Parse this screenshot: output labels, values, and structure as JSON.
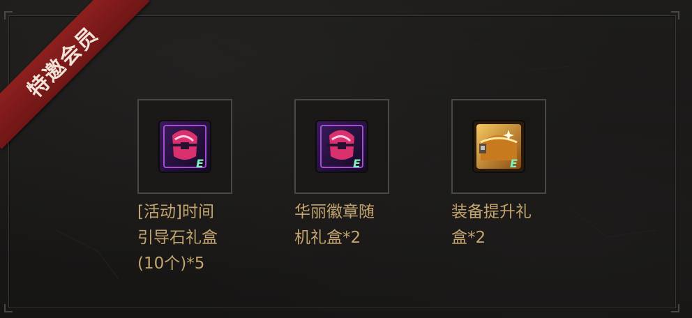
{
  "ribbon": {
    "label": "特邀会员"
  },
  "items": [
    {
      "icon": "purple-gift-box-icon",
      "line1": "[活动]时间",
      "line2": "引导石礼盒",
      "line3": "(10个)*5"
    },
    {
      "icon": "purple-gift-box-icon",
      "line1": "华丽徽章随",
      "line2": "机礼盒*2",
      "line3": ""
    },
    {
      "icon": "gold-treasure-chest-icon",
      "line1": "装备提升礼",
      "line2": "盒*2",
      "line3": ""
    }
  ],
  "colors": {
    "ribbon": "#8e1f1f",
    "text": "#c4a46e",
    "background": "#1a1918"
  }
}
